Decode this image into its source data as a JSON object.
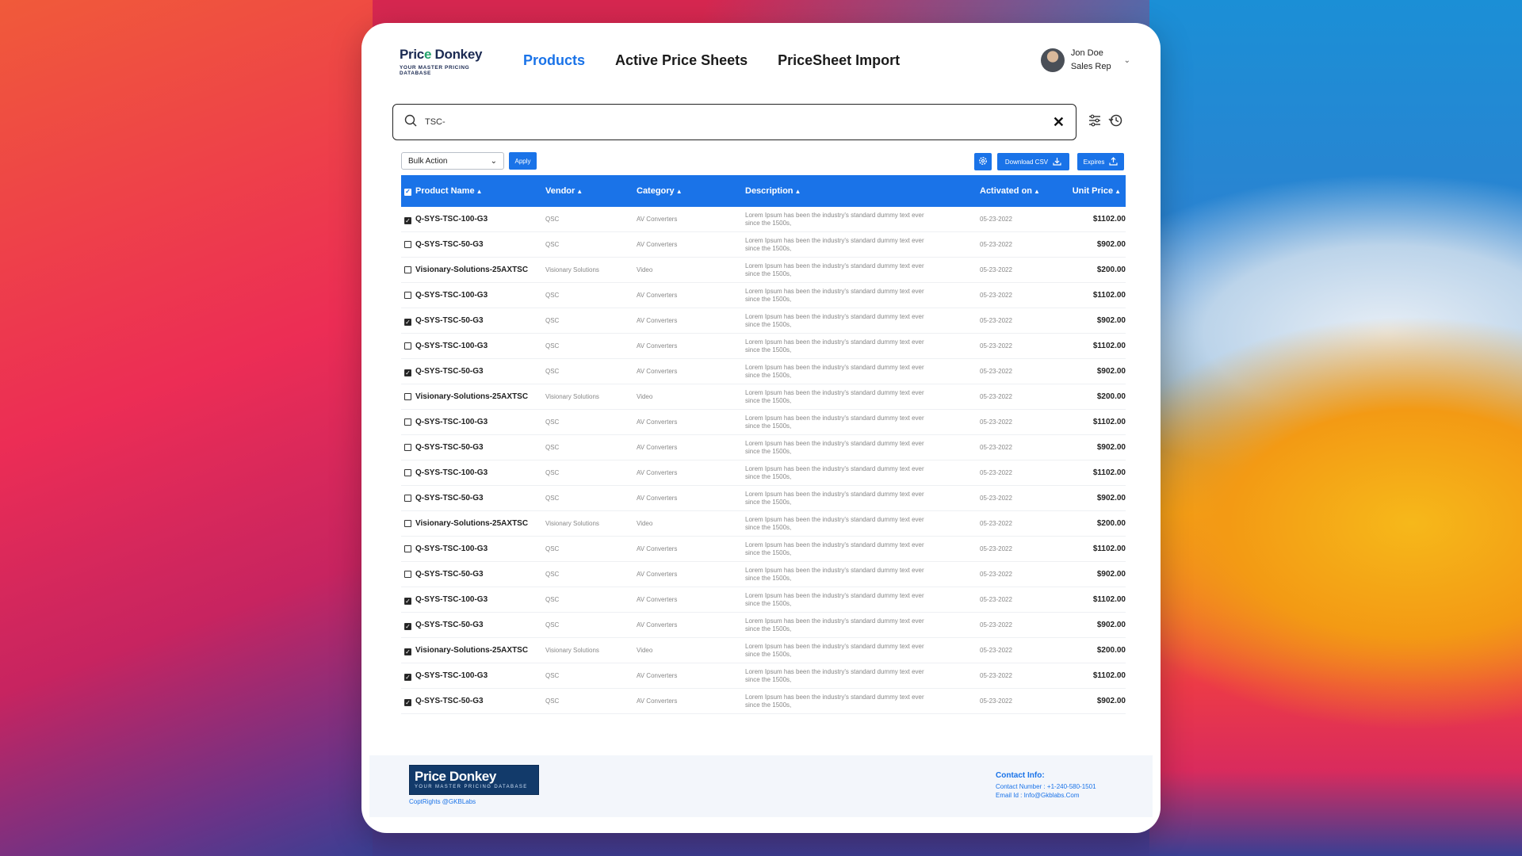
{
  "app": {
    "logo": {
      "name_a": "Pric",
      "name_acc": "e",
      "name_b": " Donkey",
      "tagline": "YOUR MASTER PRICING DATABASE"
    },
    "nav": [
      "Products",
      "Active Price Sheets",
      "PriceSheet Import"
    ],
    "active_nav": "Products",
    "user": {
      "name": "Jon Doe",
      "role": "Sales Rep"
    }
  },
  "search": {
    "value": "TSC-"
  },
  "toolbar": {
    "bulk_action": "Bulk Action",
    "apply": "Apply",
    "download_csv": "Download CSV",
    "expires": "Expires"
  },
  "table": {
    "columns": [
      "Product Name",
      "Vendor",
      "Category",
      "Description",
      "Activated on",
      "Unit Price"
    ],
    "rows": [
      {
        "checked": true,
        "name": "Q-SYS-TSC-100-G3",
        "vendor": "QSC",
        "category": "AV Converters",
        "desc1": "Lorem Ipsum has been the industry's standard dummy text ever",
        "desc2": "since the 1500s,",
        "date": "05-23-2022",
        "price": "$1102.00"
      },
      {
        "checked": false,
        "name": "Q-SYS-TSC-50-G3",
        "vendor": "QSC",
        "category": "AV Converters",
        "desc1": "Lorem Ipsum has been the industry's standard dummy text ever",
        "desc2": "since the 1500s,",
        "date": "05-23-2022",
        "price": "$902.00"
      },
      {
        "checked": false,
        "name": "Visionary-Solutions-25AXTSC",
        "vendor": "Visionary Solutions",
        "category": "Video",
        "desc1": "Lorem Ipsum has been the industry's standard dummy text ever",
        "desc2": "since the 1500s,",
        "date": "05-23-2022",
        "price": "$200.00"
      },
      {
        "checked": false,
        "name": "Q-SYS-TSC-100-G3",
        "vendor": "QSC",
        "category": "AV Converters",
        "desc1": "Lorem Ipsum has been the industry's standard dummy text ever",
        "desc2": "since the 1500s,",
        "date": "05-23-2022",
        "price": "$1102.00"
      },
      {
        "checked": true,
        "name": "Q-SYS-TSC-50-G3",
        "vendor": "QSC",
        "category": "AV Converters",
        "desc1": "Lorem Ipsum has been the industry's standard dummy text ever",
        "desc2": "since the 1500s,",
        "date": "05-23-2022",
        "price": "$902.00"
      },
      {
        "checked": false,
        "name": "Q-SYS-TSC-100-G3",
        "vendor": "QSC",
        "category": "AV Converters",
        "desc1": "Lorem Ipsum has been the industry's standard dummy text ever",
        "desc2": "since the 1500s,",
        "date": "05-23-2022",
        "price": "$1102.00"
      },
      {
        "checked": true,
        "name": "Q-SYS-TSC-50-G3",
        "vendor": "QSC",
        "category": "AV Converters",
        "desc1": "Lorem Ipsum has been the industry's standard dummy text ever",
        "desc2": "since the 1500s,",
        "date": "05-23-2022",
        "price": "$902.00"
      },
      {
        "checked": false,
        "name": "Visionary-Solutions-25AXTSC",
        "vendor": "Visionary Solutions",
        "category": "Video",
        "desc1": "Lorem Ipsum has been the industry's standard dummy text ever",
        "desc2": "since the 1500s,",
        "date": "05-23-2022",
        "price": "$200.00"
      },
      {
        "checked": false,
        "name": "Q-SYS-TSC-100-G3",
        "vendor": "QSC",
        "category": "AV Converters",
        "desc1": "Lorem Ipsum has been the industry's standard dummy text ever",
        "desc2": "since the 1500s,",
        "date": "05-23-2022",
        "price": "$1102.00"
      },
      {
        "checked": false,
        "name": "Q-SYS-TSC-50-G3",
        "vendor": "QSC",
        "category": "AV Converters",
        "desc1": "Lorem Ipsum has been the industry's standard dummy text ever",
        "desc2": "since the 1500s,",
        "date": "05-23-2022",
        "price": "$902.00"
      },
      {
        "checked": false,
        "name": "Q-SYS-TSC-100-G3",
        "vendor": "QSC",
        "category": "AV Converters",
        "desc1": "Lorem Ipsum has been the industry's standard dummy text ever",
        "desc2": "since the 1500s,",
        "date": "05-23-2022",
        "price": "$1102.00"
      },
      {
        "checked": false,
        "name": "Q-SYS-TSC-50-G3",
        "vendor": "QSC",
        "category": "AV Converters",
        "desc1": "Lorem Ipsum has been the industry's standard dummy text ever",
        "desc2": "since the 1500s,",
        "date": "05-23-2022",
        "price": "$902.00"
      },
      {
        "checked": false,
        "name": "Visionary-Solutions-25AXTSC",
        "vendor": "Visionary Solutions",
        "category": "Video",
        "desc1": "Lorem Ipsum has been the industry's standard dummy text ever",
        "desc2": "since the 1500s,",
        "date": "05-23-2022",
        "price": "$200.00"
      },
      {
        "checked": false,
        "name": "Q-SYS-TSC-100-G3",
        "vendor": "QSC",
        "category": "AV Converters",
        "desc1": "Lorem Ipsum has been the industry's standard dummy text ever",
        "desc2": "since the 1500s,",
        "date": "05-23-2022",
        "price": "$1102.00"
      },
      {
        "checked": false,
        "name": "Q-SYS-TSC-50-G3",
        "vendor": "QSC",
        "category": "AV Converters",
        "desc1": "Lorem Ipsum has been the industry's standard dummy text ever",
        "desc2": "since the 1500s,",
        "date": "05-23-2022",
        "price": "$902.00"
      },
      {
        "checked": true,
        "name": "Q-SYS-TSC-100-G3",
        "vendor": "QSC",
        "category": "AV Converters",
        "desc1": "Lorem Ipsum has been the industry's standard dummy text ever",
        "desc2": "since the 1500s,",
        "date": "05-23-2022",
        "price": "$1102.00"
      },
      {
        "checked": true,
        "name": "Q-SYS-TSC-50-G3",
        "vendor": "QSC",
        "category": "AV Converters",
        "desc1": "Lorem Ipsum has been the industry's standard dummy text ever",
        "desc2": "since the 1500s,",
        "date": "05-23-2022",
        "price": "$902.00"
      },
      {
        "checked": true,
        "name": "Visionary-Solutions-25AXTSC",
        "vendor": "Visionary Solutions",
        "category": "Video",
        "desc1": "Lorem Ipsum has been the industry's standard dummy text ever",
        "desc2": "since the 1500s,",
        "date": "05-23-2022",
        "price": "$200.00"
      },
      {
        "checked": true,
        "name": "Q-SYS-TSC-100-G3",
        "vendor": "QSC",
        "category": "AV Converters",
        "desc1": "Lorem Ipsum has been the industry's standard dummy text ever",
        "desc2": "since the 1500s,",
        "date": "05-23-2022",
        "price": "$1102.00"
      },
      {
        "checked": true,
        "name": "Q-SYS-TSC-50-G3",
        "vendor": "QSC",
        "category": "AV Converters",
        "desc1": "Lorem Ipsum has been the industry's standard dummy text ever",
        "desc2": "since the 1500s,",
        "date": "05-23-2022",
        "price": "$902.00"
      }
    ]
  },
  "footer": {
    "logo_name": "Price Donkey",
    "logo_tagline": "YOUR MASTER PRICING DATABASE",
    "copyright": "CoptRights @GKBLabs",
    "contact_heading": "Contact Info:",
    "contact_number": "Contact Number : +1-240-580-1501",
    "contact_email": "Email Id : Info@Gkblabs.Com"
  },
  "colors": {
    "accent": "#1a73e8",
    "text": "#222222",
    "muted": "#888888"
  },
  "icons": [
    "search-icon",
    "close-icon",
    "filter-sliders-icon",
    "history-icon",
    "gear-icon",
    "download-icon",
    "upload-icon",
    "chevron-down-icon"
  ]
}
